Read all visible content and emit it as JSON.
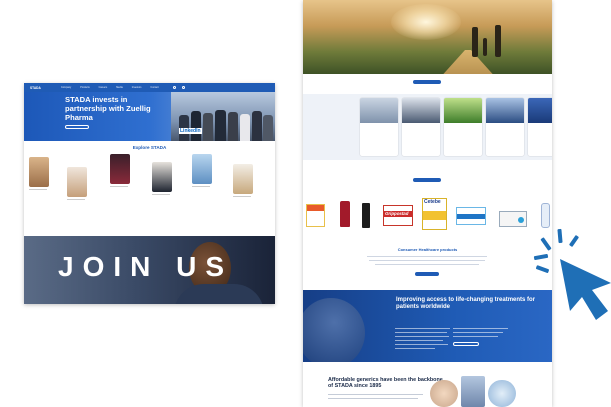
{
  "left_page": {
    "nav": {
      "logo": "STADA",
      "items": [
        "Company",
        "Products",
        "Careers",
        "Media",
        "Investors",
        "Contact"
      ]
    },
    "hero": {
      "title": "STADA invests in partnership with Zuellig Pharma",
      "subtitle": "",
      "button_label": "",
      "badge": "LinkedIn"
    },
    "explore_title": "Explore STADA",
    "cards": [
      {
        "label": ""
      },
      {
        "label": ""
      },
      {
        "label": ""
      },
      {
        "label": ""
      },
      {
        "label": ""
      },
      {
        "label": ""
      }
    ],
    "join_text": "JOIN US"
  },
  "right_page": {
    "hero_button": "",
    "news_more_button": "",
    "news": [
      {
        "category": "",
        "title": ""
      },
      {
        "category": "",
        "title": ""
      },
      {
        "category": "",
        "title": ""
      },
      {
        "category": "",
        "title": ""
      },
      {
        "category": "",
        "title": ""
      }
    ],
    "products": [
      "",
      "Grippostad",
      "Cetebe",
      "",
      "",
      "",
      ""
    ],
    "consumer_title": "Consumer Healthcare products",
    "consumer_button": "",
    "improve_title": "Improving access to life-changing treatments for patients worldwide",
    "improve_button": "",
    "generics_title": "Affordable generics have been the backbone of STADA since 1895"
  },
  "colors": {
    "brand_blue": "#1f5bb5",
    "cursor_blue": "#1f6fb6"
  },
  "icons": [
    "cursor-click-icon",
    "linkedin-badge"
  ]
}
